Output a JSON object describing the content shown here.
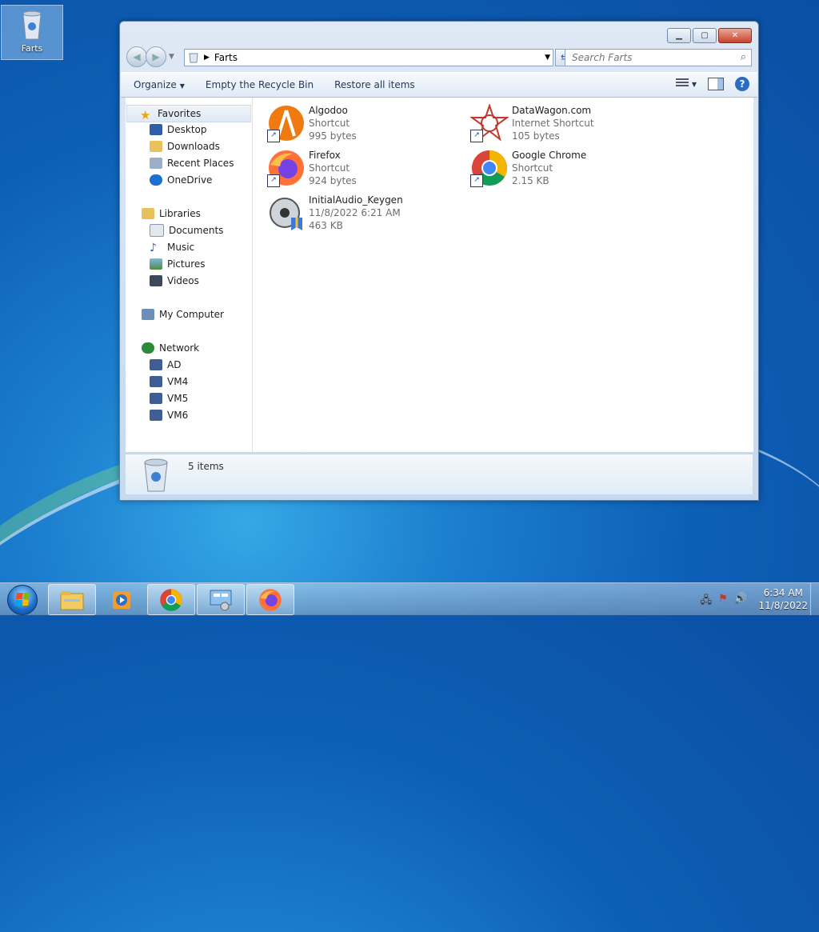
{
  "desktop": {
    "icon_label": "Farts"
  },
  "window": {
    "address": {
      "breadcrumb": "Farts"
    },
    "search": {
      "placeholder": "Search Farts"
    },
    "toolbar": {
      "organize": "Organize",
      "empty_bin": "Empty the Recycle Bin",
      "restore_all": "Restore all items"
    },
    "nav": {
      "favorites": "Favorites",
      "favorites_items": [
        "Desktop",
        "Downloads",
        "Recent Places",
        "OneDrive"
      ],
      "libraries": "Libraries",
      "libraries_items": [
        "Documents",
        "Music",
        "Pictures",
        "Videos"
      ],
      "computer": "My Computer",
      "network": "Network",
      "network_items": [
        "AD",
        "VM4",
        "VM5",
        "VM6"
      ]
    },
    "files": [
      {
        "name": "Algodoo",
        "line2": "Shortcut",
        "line3": "995 bytes",
        "icon": "algodoo-icon"
      },
      {
        "name": "DataWagon.com",
        "line2": "Internet Shortcut",
        "line3": "105 bytes",
        "icon": "datawagon-icon"
      },
      {
        "name": "Firefox",
        "line2": "Shortcut",
        "line3": "924 bytes",
        "icon": "firefox-icon"
      },
      {
        "name": "Google Chrome",
        "line2": "Shortcut",
        "line3": "2.15 KB",
        "icon": "chrome-icon"
      },
      {
        "name": "InitialAudio_Keygen",
        "line2": "11/8/2022 6:21 AM",
        "line3": "463 KB",
        "icon": "keygen-icon"
      }
    ],
    "details": {
      "count": "5 items"
    }
  },
  "taskbar": {
    "apps": [
      "explorer-icon",
      "media-player-icon",
      "chrome-icon",
      "control-panel-icon",
      "firefox-icon"
    ],
    "clock": {
      "time": "6:34 AM",
      "date": "11/8/2022"
    }
  }
}
